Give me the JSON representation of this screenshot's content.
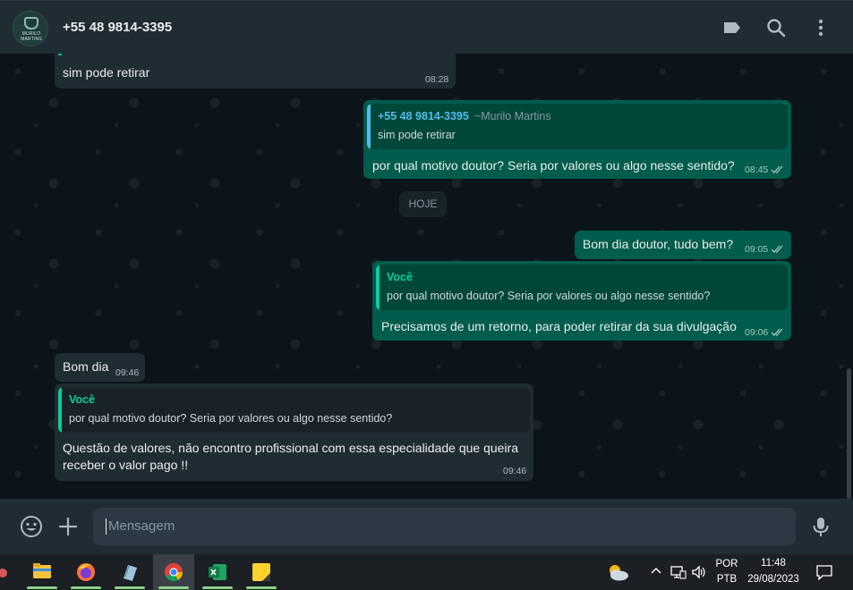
{
  "header": {
    "avatar_logo_text": "MURILO MARTINS",
    "contact_title": "+55 48 9814-3395",
    "icons": [
      "label-icon",
      "search-icon",
      "more-vertical-icon"
    ]
  },
  "messages": {
    "m1": {
      "text": "sim pode retirar",
      "time": "08:28"
    },
    "m2": {
      "quote_name": "+55 48 9814-3395",
      "quote_extra": "~Murilo Martins",
      "quote_text": "sim pode retirar",
      "text": "por qual motivo doutor? Seria por valores ou algo nesse sentido?",
      "time": "08:45"
    },
    "day_badge": "HOJE",
    "m3": {
      "text": "Bom dia doutor, tudo bem?",
      "time": "09:05"
    },
    "m4": {
      "quote_name": "Você",
      "quote_text": "por qual motivo doutor? Seria por valores ou algo nesse sentido?",
      "text": "Precisamos de um retorno, para poder retirar da sua divulgação",
      "time": "09:06"
    },
    "m5": {
      "text": "Bom dia",
      "time": "09:46"
    },
    "m6": {
      "quote_name": "Você",
      "quote_text": "por qual motivo doutor? Seria por valores ou algo nesse sentido?",
      "text": "Questão de valores, não encontro profissional com essa especialidade que queira\nreceber o valor pago !!",
      "time": "09:46"
    }
  },
  "composer": {
    "placeholder": "Mensagem",
    "icons": [
      "emoji-icon",
      "attach-plus-icon",
      "microphone-icon"
    ]
  },
  "taskbar": {
    "apps": [
      "file-explorer-icon",
      "firefox-icon",
      "notepad-icon",
      "chrome-icon",
      "excel-icon",
      "sticky-notes-icon"
    ],
    "active_app": "chrome-icon",
    "lang_top": "POR",
    "lang_bottom": "PTB",
    "clock_time": "11:48",
    "clock_date": "29/08/2023"
  },
  "colors": {
    "incoming_bubble": "#202c33",
    "outgoing_bubble": "#005c4b",
    "accent_blue": "#53bdeb",
    "accent_green": "#06cf9c",
    "background": "#0b141a"
  }
}
